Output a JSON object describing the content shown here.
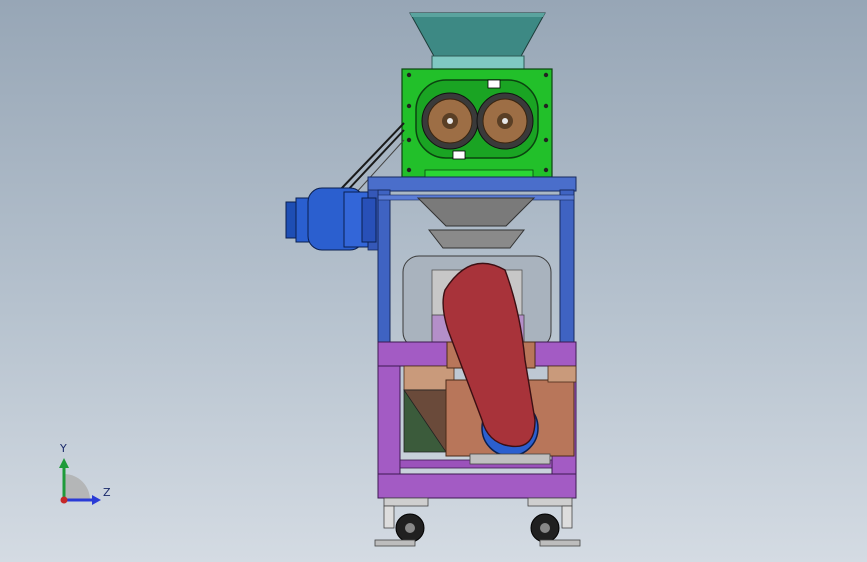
{
  "viewport": {
    "background_top": "#97a6b6",
    "background_bottom": "#d4dbe3"
  },
  "triad": {
    "y_label": "Y",
    "z_label": "Z",
    "y_color": "#1e9b3a",
    "z_color": "#2a3bd6",
    "origin_color": "#c62828"
  },
  "model": {
    "hopper_color": "#3f8a86",
    "gearbox_color": "#22c02a",
    "motor_color": "#2b5fcf",
    "frame_color": "#3f63c2",
    "base_color": "#a35bc4",
    "belt_color": "#a8333a",
    "housing_color": "#b8765a",
    "wheel_color": "#202020"
  }
}
